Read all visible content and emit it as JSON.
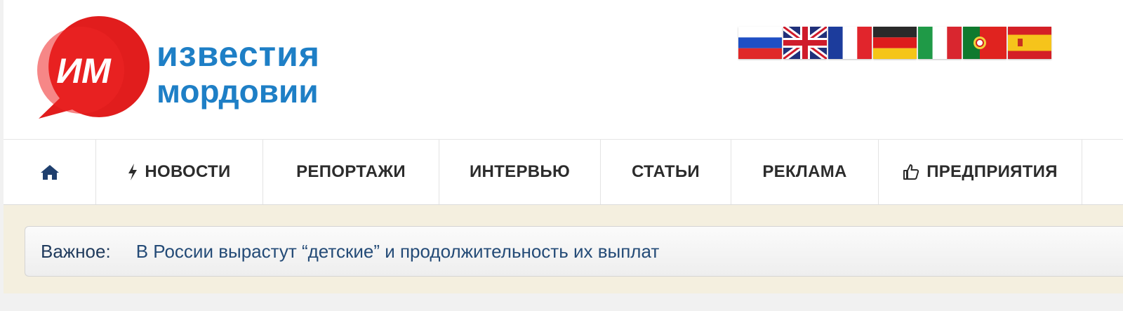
{
  "header": {
    "logo": {
      "badge_text": "ИМ",
      "name_line1": "известия",
      "name_line2": "мордовии",
      "brand_red": "#e11d1d",
      "brand_blue": "#1e7fc6"
    },
    "languages": [
      {
        "code": "ru",
        "icon": "russia-flag-icon"
      },
      {
        "code": "en",
        "icon": "uk-flag-icon"
      },
      {
        "code": "fr",
        "icon": "france-flag-icon"
      },
      {
        "code": "de",
        "icon": "germany-flag-icon"
      },
      {
        "code": "it",
        "icon": "italy-flag-icon"
      },
      {
        "code": "pt",
        "icon": "portugal-flag-icon"
      },
      {
        "code": "es",
        "icon": "spain-flag-icon"
      }
    ]
  },
  "nav": {
    "home_icon": "home-icon",
    "items": [
      {
        "label": "НОВОСТИ",
        "icon": "bolt-icon"
      },
      {
        "label": "РЕПОРТАЖИ"
      },
      {
        "label": "ИНТЕРВЬЮ"
      },
      {
        "label": "СТАТЬИ"
      },
      {
        "label": "РЕКЛАМА"
      },
      {
        "label": "ПРЕДПРИЯТИЯ",
        "icon": "thumbs-up-icon"
      }
    ]
  },
  "ticker": {
    "label": "Важное:",
    "headline": "В России вырастут “детские” и продолжительность их выплат"
  },
  "colors": {
    "nav_text": "#2c2c2c",
    "home_icon": "#1f3f6e",
    "ticker_bg_area": "#f4efdf",
    "ticker_label": "#1f3a5c",
    "ticker_link": "#244b77"
  }
}
